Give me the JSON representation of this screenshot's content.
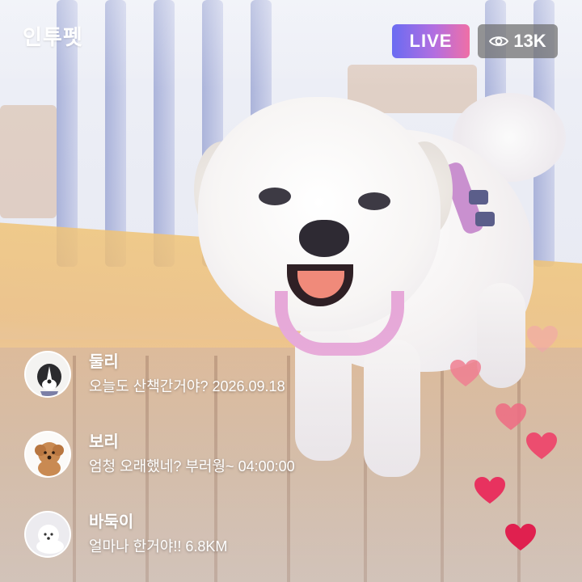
{
  "app": {
    "logo": "인투펫"
  },
  "stream": {
    "live_label": "LIVE",
    "viewer_count": "13K",
    "viewer_icon": "eye-icon"
  },
  "comments": [
    {
      "name": "둘리",
      "text": "오늘도 산책간거야? 2026.09.18",
      "avatar": "black-white-dog-avatar"
    },
    {
      "name": "보리",
      "text": "엄청 오래했네? 부러웡~ 04:00:00",
      "avatar": "brown-poodle-avatar"
    },
    {
      "name": "바둑이",
      "text": "얼마나 한거야!! 6.8KM",
      "avatar": "white-spitz-avatar"
    }
  ],
  "reactions": {
    "icon": "heart-icon",
    "colors": [
      "#f4a3ad",
      "#f07f92",
      "#ef6b83",
      "#ec4d6f",
      "#e8325f",
      "#e0204f"
    ]
  }
}
